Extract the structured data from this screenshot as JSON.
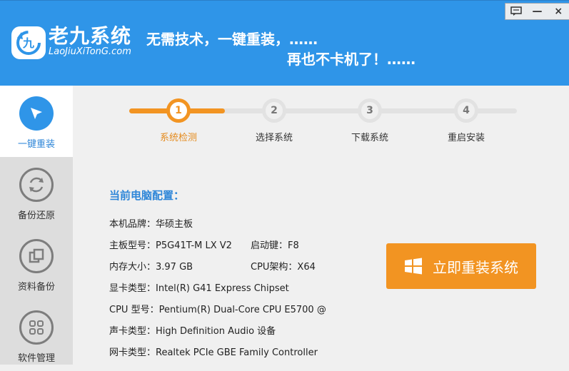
{
  "header": {
    "title": "老九系统",
    "subtitle": "LaoJiuXiTonG.com",
    "slogan_line1": "无需技术，一键重装，……",
    "slogan_line2": "再也不卡机了！……",
    "logo_glyph": "九"
  },
  "window_controls": {
    "feedback_icon": "chat-icon",
    "minimize": "—",
    "close": "×"
  },
  "sidebar": {
    "items": [
      {
        "label": "一键重装",
        "icon": "cursor-arrow-icon",
        "active": true
      },
      {
        "label": "备份还原",
        "icon": "sync-icon",
        "active": false
      },
      {
        "label": "资料备份",
        "icon": "copy-icon",
        "active": false
      },
      {
        "label": "软件管理",
        "icon": "grid-icon",
        "active": false
      }
    ]
  },
  "steps": [
    {
      "num": "1",
      "label": "系统检测",
      "active": true
    },
    {
      "num": "2",
      "label": "选择系统",
      "active": false
    },
    {
      "num": "3",
      "label": "下载系统",
      "active": false
    },
    {
      "num": "4",
      "label": "重启安装",
      "active": false
    }
  ],
  "config": {
    "title": "当前电脑配置：",
    "brand": "本机品牌：华硕主板",
    "board": "主板型号：P5G41T-M LX V2",
    "boot_key": "启动键：F8",
    "memory": "内存大小：3.97 GB",
    "cpu_arch": "CPU架构：X64",
    "gpu": "显卡类型：Intel(R) G41 Express Chipset",
    "cpu": "CPU 型号：Pentium(R) Dual-Core  CPU      E5700  @",
    "sound": "声卡类型：High Definition Audio 设备",
    "nic": "网卡类型：Realtek PCIe GBE Family Controller"
  },
  "action": {
    "reinstall_label": "立即重装系统",
    "icon": "windows-logo-icon"
  },
  "colors": {
    "header_blue": "#2f95e8",
    "accent_orange": "#f29422",
    "title_blue": "#2e86d8"
  }
}
